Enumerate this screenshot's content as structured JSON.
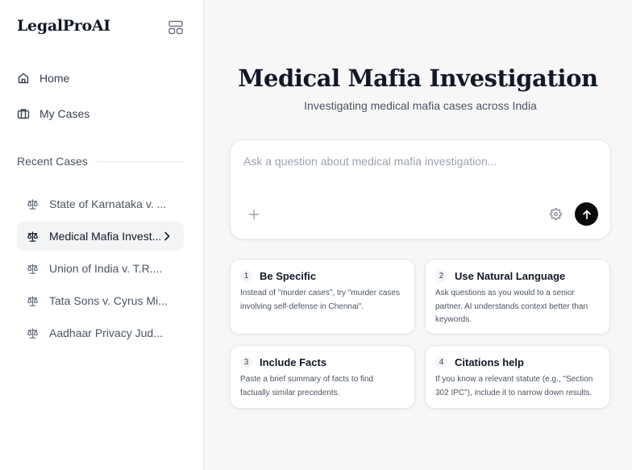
{
  "sidebar": {
    "brand": "LegalProAI",
    "nav": [
      {
        "label": "Home",
        "icon": "home-icon"
      },
      {
        "label": "My Cases",
        "icon": "briefcase-icon"
      }
    ],
    "recent_heading": "Recent Cases",
    "recent": [
      {
        "label": "State of Karnataka v. ...",
        "active": false
      },
      {
        "label": "Medical Mafia Invest...",
        "active": true
      },
      {
        "label": "Union of India v. T.R....",
        "active": false
      },
      {
        "label": "Tata Sons v. Cyrus Mi...",
        "active": false
      },
      {
        "label": "Aadhaar Privacy Jud...",
        "active": false
      }
    ]
  },
  "main": {
    "title": "Medical Mafia Investigation",
    "subtitle": "Investigating medical mafia cases across India",
    "query": {
      "placeholder": "Ask a question about medical mafia investigation...",
      "value": ""
    },
    "tips": [
      {
        "num": "1",
        "title": "Be Specific",
        "text": "Instead of \"murder cases\", try \"murder cases involving self-defense in Chennai\"."
      },
      {
        "num": "2",
        "title": "Use Natural Language",
        "text": "Ask questions as you would to a senior partner. AI understands context better than keywords."
      },
      {
        "num": "3",
        "title": "Include Facts",
        "text": "Paste a brief summary of facts to find factually similar precedents."
      },
      {
        "num": "4",
        "title": "Citations help",
        "text": "If you know a relevant statute (e.g., \"Section 302 IPC\"), include it to narrow down results."
      }
    ]
  },
  "colors": {
    "background": "#f7f7f8",
    "sidebar": "#ffffff",
    "active_item": "#f3f4f6",
    "send_button": "#0a0a0a"
  }
}
